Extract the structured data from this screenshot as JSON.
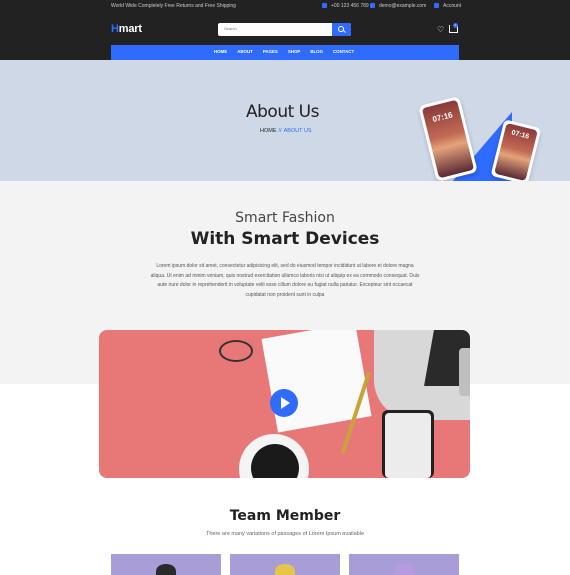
{
  "topbar": {
    "promo": "World Wide Completely Free Returns and Free Shipping",
    "phone": "+00 123 456 789",
    "email": "demo@example.com",
    "account": "Account"
  },
  "header": {
    "logo_accent": "H",
    "logo_rest": "mart",
    "search_placeholder": "Search",
    "cart_count": "0"
  },
  "nav": {
    "items": [
      "HOME",
      "ABOUT",
      "PAGES",
      "SHOP",
      "BLOG",
      "CONTACT"
    ]
  },
  "hero": {
    "title": "About Us",
    "breadcrumb_home": "HOME",
    "breadcrumb_sep": "//",
    "breadcrumb_current": "ABOUT US",
    "phone_time_1": "07:16",
    "phone_time_2": "07:16"
  },
  "about": {
    "subtitle": "Smart Fashion",
    "title": "With Smart Devices",
    "paragraph": "Lorem ipsum dolor sit amet, consectetur adipisicing elit, sed do eiusmod tempor incididunt ut labore et dolore magna aliqua. Ut enim ad minim veniam, quis nostrud exercitation ullamco laboris nisi ut aliquip ex ea commodo consequat. Duis aute irure dolor in reprehenderit in voluptate velit esse cillum dolore eu fugiat nulla pariatur. Excepteur sint occaecat cupidatat non proident sunt in culpa"
  },
  "team": {
    "title": "Team Member",
    "subtitle": "There are many variations of passages of Lorem Ipsum available"
  },
  "colors": {
    "accent": "#2f6bff",
    "topbar": "#222222",
    "hero_bg": "#cfd8e6"
  }
}
